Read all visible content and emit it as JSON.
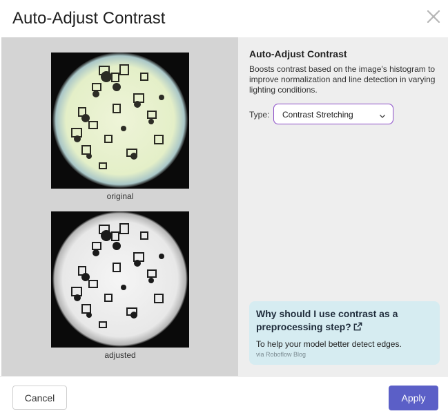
{
  "dialog": {
    "title": "Auto-Adjust Contrast",
    "close_icon": "close-icon"
  },
  "preview": {
    "original_caption": "original",
    "adjusted_caption": "adjusted"
  },
  "panel": {
    "title": "Auto-Adjust Contrast",
    "description": "Boosts contrast based on the image's histogram to improve normalization and line detection in varying lighting conditions.",
    "type_label": "Type:",
    "type_value": "Contrast Stretching",
    "chevron_icon": "chevron-down-icon"
  },
  "tip": {
    "title": "Why should I use contrast as a preprocessing step?",
    "link_icon": "external-link-icon",
    "text": "To help your model better detect edges.",
    "source": "via Roboflow Blog"
  },
  "footer": {
    "cancel_label": "Cancel",
    "apply_label": "Apply"
  },
  "colors": {
    "accent": "#5b5fc7",
    "select_border": "#8a4bc7",
    "tip_bg": "#d6ecf1"
  }
}
